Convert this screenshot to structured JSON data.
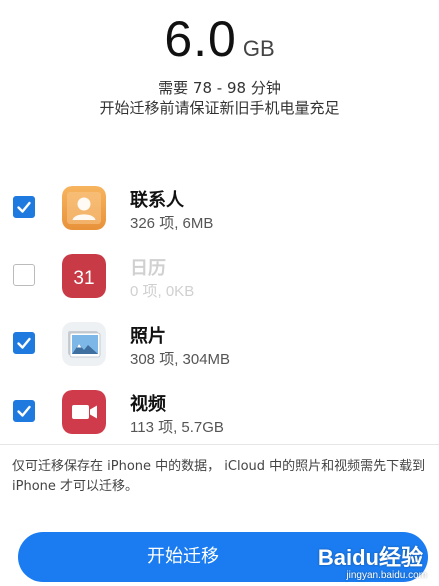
{
  "summary": {
    "size_value": "6.0",
    "size_unit": "GB",
    "estimate": "需要 78 - 98 分钟",
    "warning": "开始迁移前请保证新旧手机电量充足"
  },
  "items": [
    {
      "name": "联系人",
      "detail": "326 项, 6MB",
      "checked": true,
      "icon": "contacts-icon"
    },
    {
      "name": "日历",
      "detail": "0 项, 0KB",
      "checked": false,
      "icon": "calendar-icon",
      "icon_text": "31"
    },
    {
      "name": "照片",
      "detail": "308 项, 304MB",
      "checked": true,
      "icon": "photos-icon"
    },
    {
      "name": "视频",
      "detail": "113 项, 5.7GB",
      "checked": true,
      "icon": "video-icon"
    }
  ],
  "footnote": "仅可迁移保存在 iPhone 中的数据， iCloud 中的照片和视频需先下载到 iPhone 才可以迁移。",
  "start_button_label": "开始迁移",
  "watermark": {
    "logo": "Baidu经验",
    "url": "jingyan.baidu.com"
  },
  "colors": {
    "accent": "#1a7cf0",
    "checkbox": "#1f7ae0",
    "contacts": "#f0a04b",
    "calendar": "#c73a46",
    "video": "#cf3b4a"
  }
}
